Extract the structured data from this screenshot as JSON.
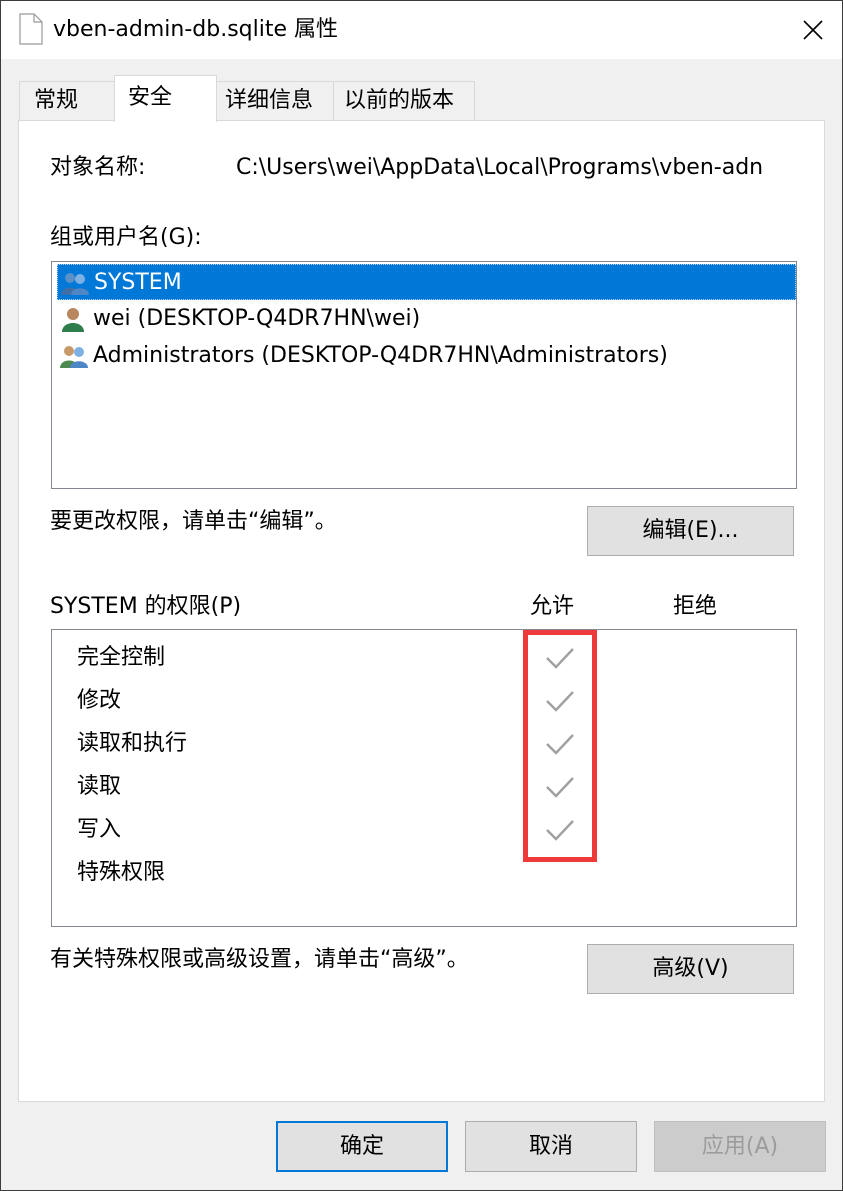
{
  "window": {
    "title": "vben-admin-db.sqlite 属性"
  },
  "tabs": [
    {
      "label": "常规"
    },
    {
      "label": "安全"
    },
    {
      "label": "详细信息"
    },
    {
      "label": "以前的版本"
    }
  ],
  "security": {
    "object_name_label": "对象名称:",
    "object_name_value": "C:\\Users\\wei\\AppData\\Local\\Programs\\vben-adn",
    "groups_label": "组或用户名(G):",
    "users": [
      {
        "name": "SYSTEM",
        "icon": "group-users-icon",
        "selected": true
      },
      {
        "name": "wei (DESKTOP-Q4DR7HN\\wei)",
        "icon": "user-icon",
        "selected": false
      },
      {
        "name": "Administrators (DESKTOP-Q4DR7HN\\Administrators)",
        "icon": "admin-group-icon",
        "selected": false
      }
    ],
    "change_hint": "要更改权限，请单击“编辑”。",
    "edit_button": "编辑(E)...",
    "permissions_label": "SYSTEM 的权限(P)",
    "allow_header": "允许",
    "deny_header": "拒绝",
    "permissions": [
      {
        "name": "完全控制",
        "allow": true,
        "deny": false
      },
      {
        "name": "修改",
        "allow": true,
        "deny": false
      },
      {
        "name": "读取和执行",
        "allow": true,
        "deny": false
      },
      {
        "name": "读取",
        "allow": true,
        "deny": false
      },
      {
        "name": "写入",
        "allow": true,
        "deny": false
      },
      {
        "name": "特殊权限",
        "allow": false,
        "deny": false
      }
    ],
    "advanced_hint": "有关特殊权限或高级设置，请单击“高级”。",
    "advanced_button": "高级(V)"
  },
  "footer": {
    "ok_button": "确定",
    "cancel_button": "取消",
    "apply_button": "应用(A)"
  },
  "colors": {
    "selection": "#0078d7",
    "annotation_highlight": "#ef3a3c",
    "check_gray": "#a0a0a0"
  }
}
